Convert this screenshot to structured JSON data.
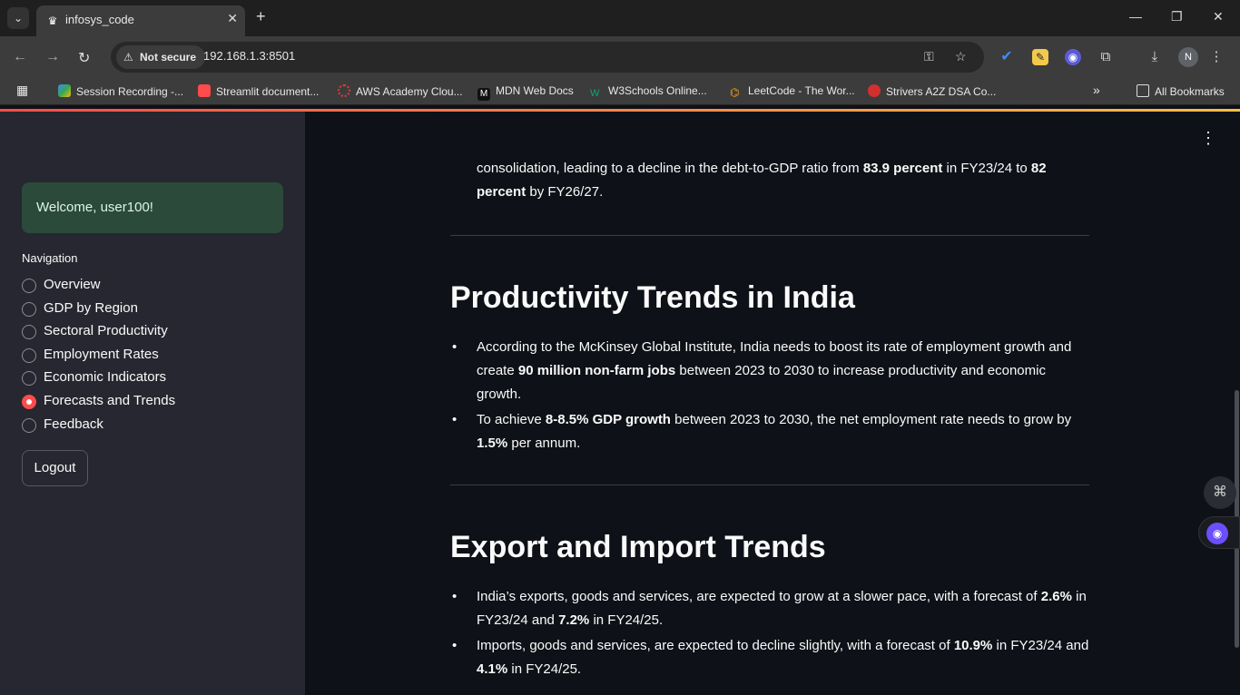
{
  "browser": {
    "tab_title": "infosys_code",
    "security_label": "Not secure",
    "url": "192.168.1.3:8501",
    "profile_initial": "N",
    "bookmarks": [
      "Session Recording -...",
      "Streamlit document...",
      "AWS Academy Clou...",
      "MDN Web Docs",
      "W3Schools Online...",
      "LeetCode - The Wor...",
      "Strivers A2Z DSA Co..."
    ],
    "all_bookmarks": "All Bookmarks"
  },
  "sidebar": {
    "welcome": "Welcome, user100!",
    "nav_title": "Navigation",
    "nav_items": [
      "Overview",
      "GDP by Region",
      "Sectoral Productivity",
      "Employment Rates",
      "Economic Indicators",
      "Forecasts and Trends",
      "Feedback"
    ],
    "selected": "Forecasts and Trends",
    "logout": "Logout"
  },
  "main": {
    "top_para": {
      "t1": "consolidation, leading to a decline in the debt-to-GDP ratio from ",
      "b1": "83.9 percent",
      "t2": " in FY23/24 to ",
      "b2": "82 percent",
      "t3": " by FY26/27."
    },
    "productivity": {
      "heading": "Productivity Trends in India",
      "b1": {
        "t1": "According to the McKinsey Global Institute, India needs to boost its rate of employment growth and create ",
        "b1": "90 million non-farm jobs",
        "t2": " between 2023 to 2030 to increase productivity and economic growth."
      },
      "b2": {
        "t1": "To achieve ",
        "b1": "8-8.5% GDP growth",
        "t2": " between 2023 to 2030, the net employment rate needs to grow by ",
        "b2": "1.5%",
        "t3": " per annum."
      }
    },
    "trade": {
      "heading": "Export and Import Trends",
      "b1": {
        "t1": "India’s exports, goods and services, are expected to grow at a slower pace, with a forecast of ",
        "b1": "2.6%",
        "t2": " in FY23/24 and ",
        "b2": "7.2%",
        "t3": " in FY24/25."
      },
      "b2": {
        "t1": "Imports, goods and services, are expected to decline slightly, with a forecast of ",
        "b1": "10.9%",
        "t2": " in FY23/24 and ",
        "b2": "4.1%",
        "t3": " in FY24/25."
      }
    }
  }
}
